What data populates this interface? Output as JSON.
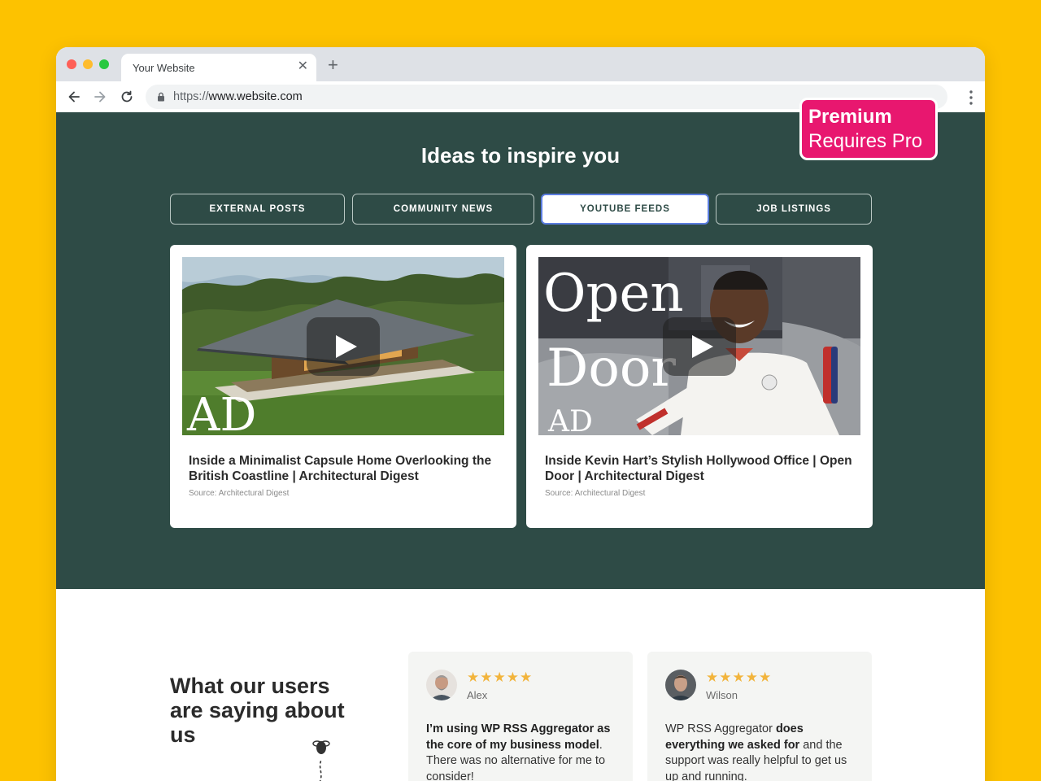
{
  "browser": {
    "tab_title": "Your Website",
    "tab_close_icon": "close-icon",
    "new_tab_label": "+",
    "url_scheme": "https://",
    "url_rest": "www.website.com"
  },
  "badge": {
    "line1": "Premium",
    "line2": "Requires Pro"
  },
  "hero": {
    "title": "Ideas to inspire you",
    "tabs": [
      {
        "label": "EXTERNAL POSTS",
        "active": false
      },
      {
        "label": "COMMUNITY NEWS",
        "active": false
      },
      {
        "label": "YOUTUBE FEEDS",
        "active": true
      },
      {
        "label": "JOB LISTINGS",
        "active": false
      }
    ]
  },
  "cards": [
    {
      "title": "Inside a Minimalist Capsule Home Overlooking the British Coastline | Architectural Digest",
      "source": "Source: Architectural Digest",
      "thumb_logo": "AD"
    },
    {
      "title": "Inside Kevin Hart’s Stylish Hollywood Office | Open Door | Architectural Digest",
      "source": "Source: Architectural Digest",
      "thumb_text_1": "Open",
      "thumb_text_2": "Door",
      "thumb_logo": "AD"
    }
  ],
  "testimonials": {
    "heading": "What our users are saying about us",
    "reviews": [
      {
        "name": "Alex",
        "stars": "★★★★★",
        "text_bold": "I’m using WP RSS Aggregator as the core of my business model",
        "text_rest": ". There was no alternative for me to consider!"
      },
      {
        "name": "Wilson",
        "stars": "★★★★★",
        "text_pre": "WP RSS Aggregator ",
        "text_bold": "does everything we asked for",
        "text_rest": " and the support was really helpful to get us up and running."
      }
    ]
  }
}
